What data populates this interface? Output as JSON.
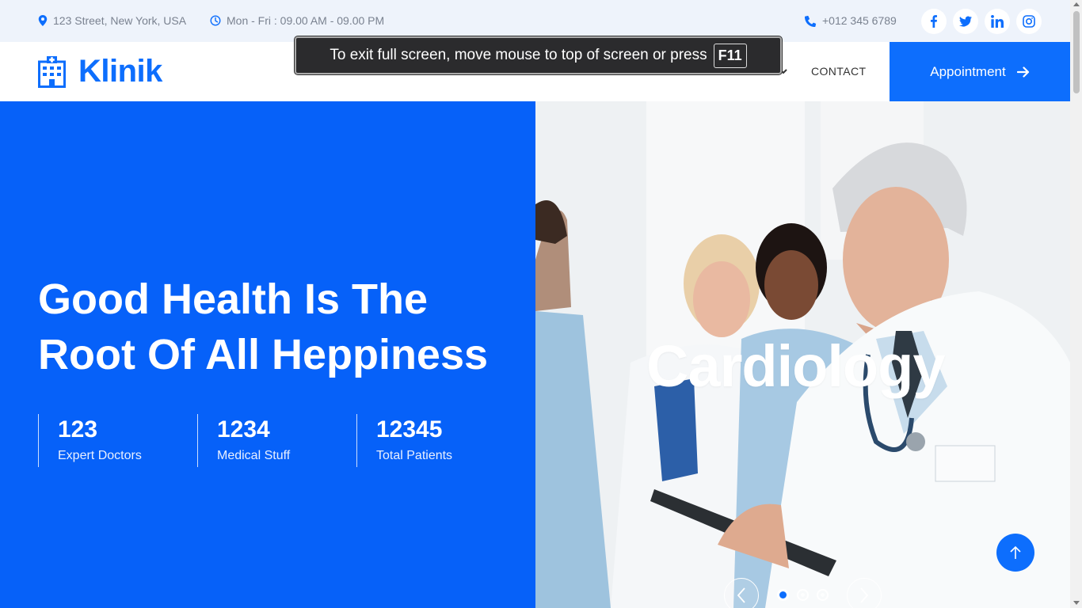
{
  "topbar": {
    "address": "123 Street, New York, USA",
    "hours": "Mon - Fri : 09.00 AM - 09.00 PM",
    "phone": "+012 345 6789",
    "socials": [
      "facebook-icon",
      "twitter-icon",
      "linkedin-icon",
      "instagram-icon"
    ]
  },
  "navbar": {
    "brand": "Klinik",
    "contact": "CONTACT",
    "appointment": "Appointment"
  },
  "hero": {
    "title_line1": "Good Health Is The",
    "title_line2": "Root Of All Heppiness",
    "stats": [
      {
        "number": "123",
        "label": "Expert Doctors"
      },
      {
        "number": "1234",
        "label": "Medical Stuff"
      },
      {
        "number": "12345",
        "label": "Total Patients"
      }
    ],
    "slide_title": "Cardiology",
    "slides_total": 3,
    "active_slide": 1
  },
  "fullscreen_notice": {
    "message": "To exit full screen, move mouse to top of screen or press",
    "key": "F11"
  },
  "colors": {
    "primary": "#0d6efd",
    "hero_blue": "#0661f9",
    "topbar_bg": "#eef3fb"
  }
}
